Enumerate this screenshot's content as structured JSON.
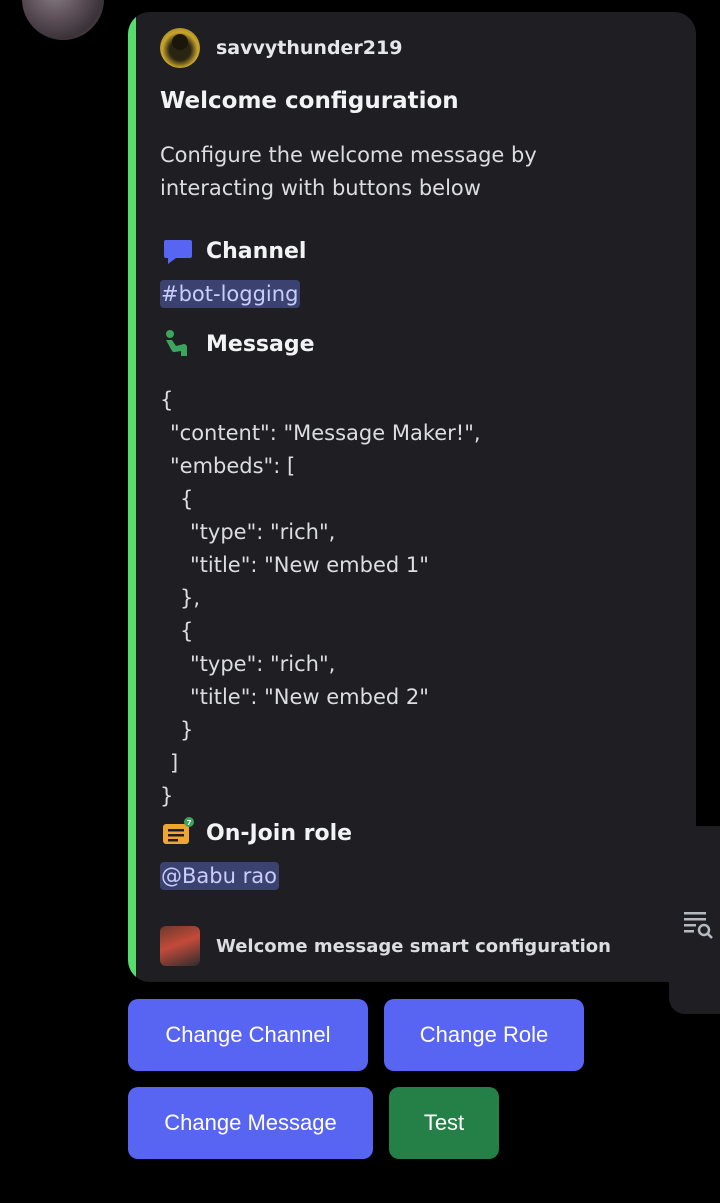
{
  "embed": {
    "author": "savvythunder219",
    "title": "Welcome configuration",
    "description": "Configure the welcome message by interacting with buttons below",
    "accent_color": "#57dd6e",
    "fields": {
      "channel": {
        "name": "Channel",
        "icon": "chat-bubble-icon",
        "value": "#bot-logging"
      },
      "message": {
        "name": "Message",
        "icon": "person-wave-icon",
        "code_lines": [
          "{",
          "\"content\": \"Message Maker!\",",
          "\"embeds\": [",
          "{",
          "\"type\": \"rich\",",
          "\"title\": \"New embed 1\"",
          "},",
          "{",
          "\"type\": \"rich\",",
          "\"title\": \"New embed 2\"",
          "}",
          "]",
          "}"
        ]
      },
      "role": {
        "name": "On-Join role",
        "icon": "ticket-chat-icon",
        "value": "@Babu rao"
      }
    },
    "footer": "Welcome message smart configuration"
  },
  "buttons": {
    "change_channel": "Change Channel",
    "change_role": "Change Role",
    "change_message": "Change Message",
    "test": "Test"
  },
  "colors": {
    "blurple": "#5865f2",
    "green": "#248046",
    "embed_bg": "#1f1f23"
  },
  "side_panel": {
    "icon": "search-list-icon"
  }
}
